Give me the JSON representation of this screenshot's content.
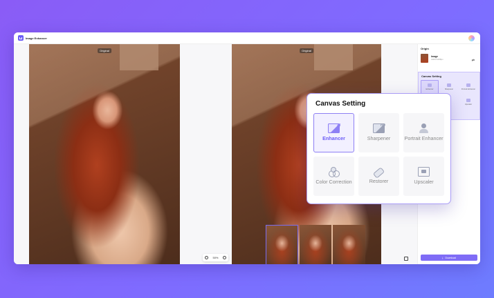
{
  "app": {
    "title": "Image Enhancer"
  },
  "canvas": {
    "left_label": "Original",
    "right_label": "Original",
    "zoom_level": "50%"
  },
  "sidebar": {
    "origin_heading": "Origin",
    "image_name": "Image",
    "image_meta": "1984*1088px",
    "canvas_heading": "Canvas Setting",
    "mini_items": [
      {
        "label": "Enhancer",
        "selected": true
      },
      {
        "label": "Sharpener",
        "selected": false
      },
      {
        "label": "Portrait Enhancer",
        "selected": false
      },
      {
        "label": "Upscaler",
        "selected": false
      }
    ],
    "download_label": "Download"
  },
  "popup": {
    "title": "Canvas Setting",
    "items": [
      {
        "label": "Enhancer",
        "icon": "ai-image-icon",
        "selected": true
      },
      {
        "label": "Sharpener",
        "icon": "hd-image-icon",
        "selected": false
      },
      {
        "label": "Portrait Enhancer",
        "icon": "portrait-icon",
        "selected": false
      },
      {
        "label": "Color Correction",
        "icon": "color-circles-icon",
        "selected": false
      },
      {
        "label": "Restorer",
        "icon": "bandage-icon",
        "selected": false
      },
      {
        "label": "Upscaler",
        "icon": "upscale-icon",
        "selected": false
      }
    ],
    "ai_tag": "AI",
    "hd_tag": "HD"
  },
  "colors": {
    "accent": "#7f6cf6",
    "background": "#8a5cf6"
  }
}
